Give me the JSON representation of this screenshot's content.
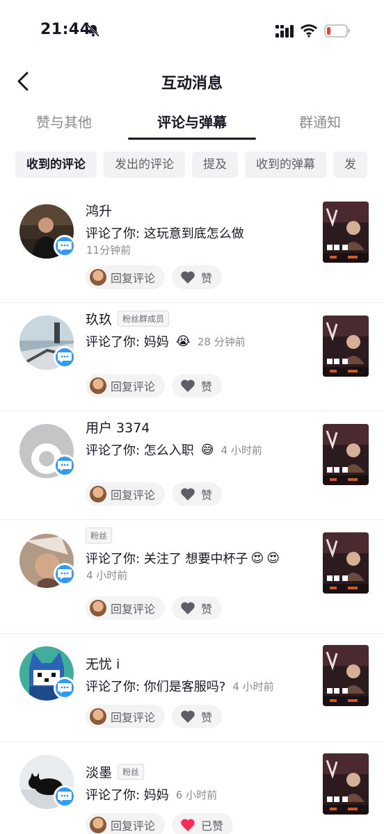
{
  "status": {
    "time": "21:44"
  },
  "header": {
    "title": "互动消息"
  },
  "tabs": [
    {
      "label": "赞与其他"
    },
    {
      "label": "评论与弹幕"
    },
    {
      "label": "群通知"
    }
  ],
  "chips": [
    {
      "label": "收到的评论"
    },
    {
      "label": "发出的评论"
    },
    {
      "label": "提及"
    },
    {
      "label": "收到的弹幕"
    },
    {
      "label": "发"
    }
  ],
  "actions": {
    "reply_label": "回复评论",
    "like_label": "赞",
    "liked_label": "已赞"
  },
  "comments": [
    {
      "name": "鸿升",
      "tag": "",
      "text": "评论了你: 这玩意到底怎么做",
      "emojis": [],
      "time": "11分钟前",
      "liked": false
    },
    {
      "name": "玖玖",
      "tag": "粉丝群成员",
      "text": "评论了你: 妈妈",
      "emojis": [
        "😭"
      ],
      "time": "28 分钟前",
      "liked": false
    },
    {
      "name": "用户 3374",
      "tag": "",
      "text": "评论了你: 怎么入职",
      "emojis": [
        "😅"
      ],
      "time": "4 小时前",
      "liked": false
    },
    {
      "name": "",
      "tag": "粉丝",
      "text": "评论了你: 关注了 想要中杯子",
      "emojis": [
        "😍",
        "😍"
      ],
      "time": "4 小时前",
      "liked": false
    },
    {
      "name": "无忧 i",
      "tag": "",
      "text": "评论了你: 你们是客服吗?",
      "emojis": [],
      "time": "4 小时前",
      "liked": false
    },
    {
      "name": "淡墨",
      "tag": "粉丝",
      "text": "评论了你: 妈妈",
      "emojis": [],
      "time": "6 小时前",
      "liked": true
    }
  ],
  "colors": {
    "accent_blue": "#2f9bf6",
    "liked_red": "#fe2c55",
    "text_primary": "#161823",
    "text_secondary": "#8a8b91"
  }
}
